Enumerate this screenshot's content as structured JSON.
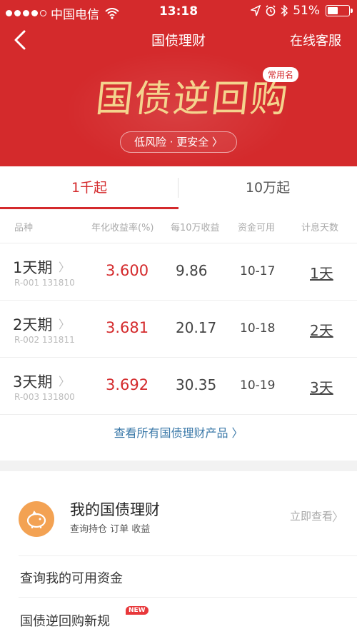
{
  "status_bar": {
    "carrier": "中国电信",
    "time": "13:18",
    "battery": "51%",
    "battery_level": 0.51
  },
  "nav": {
    "title": "国债理财",
    "service": "在线客服"
  },
  "banner": {
    "title": "国债逆回购",
    "tag": "常用名",
    "pill": "低风险 · 更安全 〉"
  },
  "tabs": [
    {
      "label": "1千起",
      "selected": true
    },
    {
      "label": "10万起",
      "selected": false
    }
  ],
  "table": {
    "headers": [
      "品种",
      "年化收益率(%)",
      "每10万收益",
      "资金可用",
      "计息天数"
    ],
    "rows": [
      {
        "name": "1天期",
        "code": "R-001 131810",
        "rate": "3.600",
        "earn": "9.86",
        "avail": "10-17",
        "days": "1天"
      },
      {
        "name": "2天期",
        "code": "R-002 131811",
        "rate": "3.681",
        "earn": "20.17",
        "avail": "10-18",
        "days": "2天"
      },
      {
        "name": "3天期",
        "code": "R-003 131800",
        "rate": "3.692",
        "earn": "30.35",
        "avail": "10-19",
        "days": "3天"
      }
    ],
    "view_all": "查看所有国债理财产品 〉"
  },
  "my": {
    "title": "我的国债理财",
    "subtitle": "查询持仓 订单 收益",
    "link": "立即查看",
    "items": [
      "查询我的可用资金",
      "国债逆回购新规"
    ],
    "new_badge": "NEW"
  },
  "colors": {
    "brand_red": "#d42a2c",
    "gold": "#f4d48e",
    "link_blue": "#3a78a8",
    "icon_orange": "#f3a253"
  }
}
